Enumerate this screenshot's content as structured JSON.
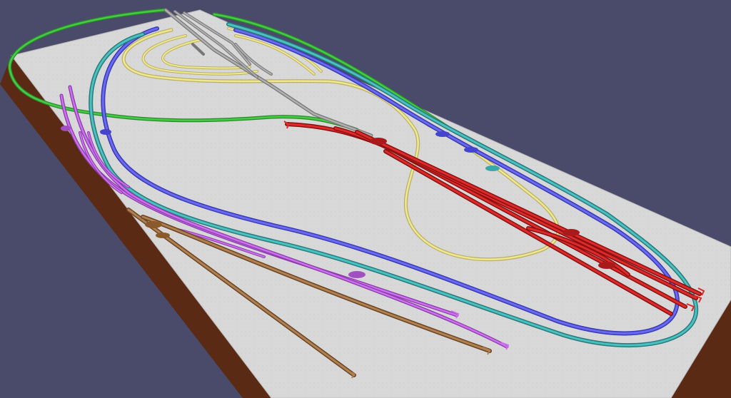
{
  "scene": {
    "background_color": "#4a4a6a",
    "board_top_color": "#d6d6d6",
    "board_edge_color": "#5a2a14",
    "track_colors": {
      "green": "#33bb33",
      "gray": "#9a9a9a",
      "yellow": "#e8e07a",
      "blue": "#5555dd",
      "teal": "#3aa8aa",
      "red": "#cc1f1f",
      "purple": "#c060e0",
      "brown": "#9a6a3a"
    }
  }
}
